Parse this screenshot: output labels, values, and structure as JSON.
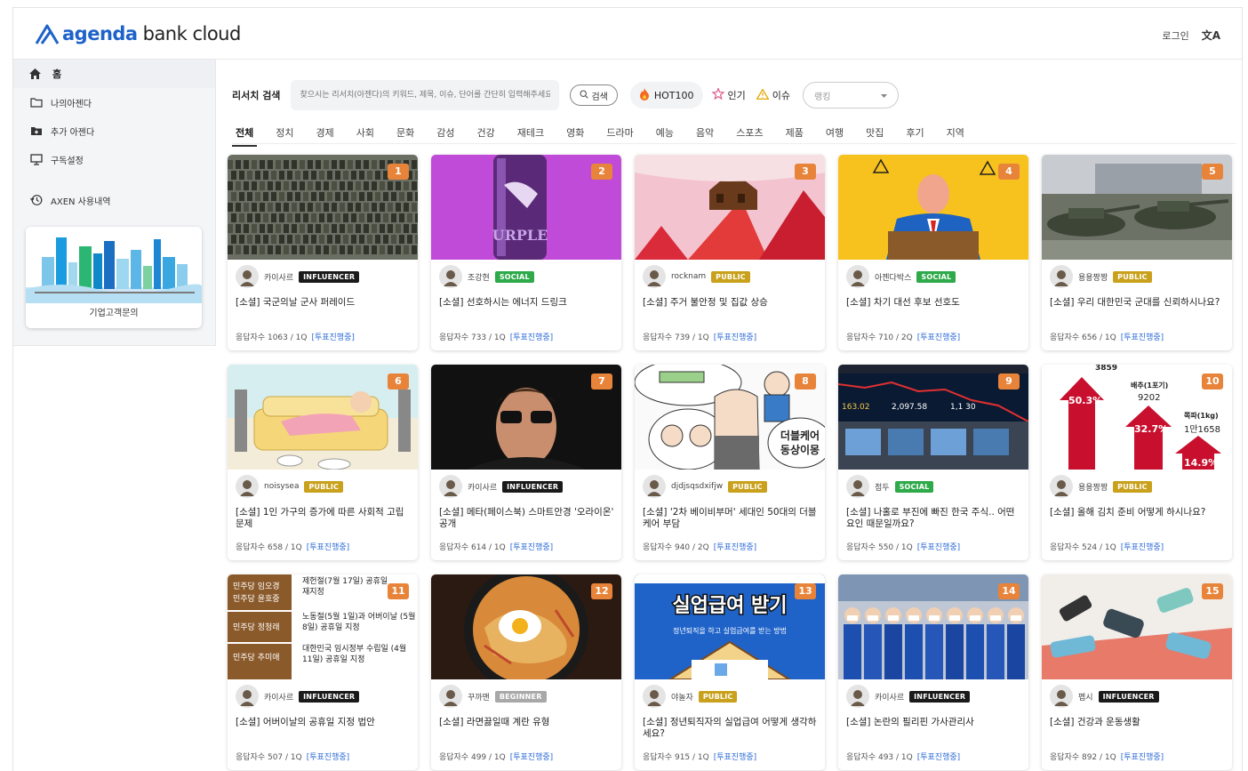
{
  "header": {
    "brand_a": "agenda",
    "brand_b": "bank cloud",
    "login": "로그인",
    "translate_icon": "translate-icon"
  },
  "sidebar": {
    "home": "홈",
    "items": [
      {
        "label": "나의아젠다",
        "icon": "folder-icon"
      },
      {
        "label": "추가 아젠다",
        "icon": "folder-plus-icon"
      },
      {
        "label": "구독설정",
        "icon": "monitor-icon"
      },
      {
        "label": "AXEN 사용내역",
        "icon": "history-icon"
      }
    ],
    "card_label": "기업고객문의"
  },
  "search": {
    "title": "리서치 검색",
    "placeholder": "찾으시는 리서치(아젠다)의 키워드, 제목, 이슈, 단어를 간단히 입력해주세요",
    "button": "검색",
    "hot": "HOT100",
    "popular": "인기",
    "issue": "이슈",
    "select_value": "랭킹"
  },
  "tabs": [
    "전체",
    "정치",
    "경제",
    "사회",
    "문화",
    "감성",
    "건강",
    "재테크",
    "영화",
    "드라마",
    "예능",
    "음악",
    "스포츠",
    "제품",
    "여행",
    "맛집",
    "후기",
    "지역"
  ],
  "badge_colors": {
    "INFLUENCER": "#1a1a1a",
    "SOCIAL": "#2eaa4a",
    "PUBLIC": "#c9a11c",
    "BEGINNER": "#a8a8a8"
  },
  "accent": "#e8843a",
  "cards": [
    {
      "rank": "1",
      "author": "카이사르",
      "badge": "INFLUENCER",
      "title": "[소셜] 국군의날 군사 퍼레이드",
      "stat": "응답자수 1063 / 1Q",
      "vote": "[투표진행중]"
    },
    {
      "rank": "2",
      "author": "조강현",
      "badge": "SOCIAL",
      "title": "[소셜] 선호하시는 에너지 드링크",
      "stat": "응답자수 733 / 1Q",
      "vote": "[투표진행중]"
    },
    {
      "rank": "3",
      "author": "rocknam",
      "badge": "PUBLIC",
      "title": "[소셜] 주거 불안정 및 집값 상승",
      "stat": "응답자수 739 / 1Q",
      "vote": "[투표진행중]"
    },
    {
      "rank": "4",
      "author": "아젠다박스",
      "badge": "SOCIAL",
      "title": "[소셜] 차기 대선 후보 선호도",
      "stat": "응답자수 710 / 2Q",
      "vote": "[투표진행중]"
    },
    {
      "rank": "5",
      "author": "용용짱짱",
      "badge": "PUBLIC",
      "title": "[소셜] 우리 대한민국 군대를 신뢰하시나요?",
      "stat": "응답자수 656 / 1Q",
      "vote": "[투표진행중]"
    },
    {
      "rank": "6",
      "author": "noisysea",
      "badge": "PUBLIC",
      "title": "[소셜] 1인 가구의 증가에 따른 사회적 고립 문제",
      "stat": "응답자수 658 / 1Q",
      "vote": "[투표진행중]"
    },
    {
      "rank": "7",
      "author": "카이사르",
      "badge": "INFLUENCER",
      "title": "[소셜] 메타(페이스북) 스마트안경 '오라이온' 공개",
      "stat": "응답자수 614 / 1Q",
      "vote": "[투표진행중]"
    },
    {
      "rank": "8",
      "author": "djdjsqsdxifjw",
      "badge": "PUBLIC",
      "title": "[소셜] '2차 베이비부머' 세대인 50대의 더블케어 부담",
      "stat": "응답자수 940 / 2Q",
      "vote": "[투표진행중]"
    },
    {
      "rank": "9",
      "author": "점두",
      "badge": "SOCIAL",
      "title": "[소셜] 나홀로 부진에 빠진 한국 주식.. 어떤 요인 때문일까요?",
      "stat": "응답자수 550 / 1Q",
      "vote": "[투표진행중]"
    },
    {
      "rank": "10",
      "author": "용용짱짱",
      "badge": "PUBLIC",
      "title": "[소셜] 올해 김치 준비 어떻게 하시나요?",
      "stat": "응답자수 524 / 1Q",
      "vote": "[투표진행중]"
    },
    {
      "rank": "11",
      "author": "카이사르",
      "badge": "INFLUENCER",
      "title": "[소셜] 어버이날의 공휴일 지정 법안",
      "stat": "응답자수 507 / 1Q",
      "vote": "[투표진행중]"
    },
    {
      "rank": "12",
      "author": "꾸까맨",
      "badge": "BEGINNER",
      "title": "[소셜] 라면끓일때 계란 유형",
      "stat": "응답자수 499 / 1Q",
      "vote": "[투표진행중]"
    },
    {
      "rank": "13",
      "author": "야놀자",
      "badge": "PUBLIC",
      "title": "[소셜] 정년퇴직자의 실업급여 어떻게 생각하세요?",
      "stat": "응답자수 915 / 1Q",
      "vote": "[투표진행중]"
    },
    {
      "rank": "14",
      "author": "카이사르",
      "badge": "INFLUENCER",
      "title": "[소셜] 논란의 필리핀 가사관리사",
      "stat": "응답자수 493 / 1Q",
      "vote": "[투표진행중]"
    },
    {
      "rank": "15",
      "author": "펩시",
      "badge": "INFLUENCER",
      "title": "[소셜] 건강과 운동생활",
      "stat": "응답자수 892 / 1Q",
      "vote": "[투표진행중]"
    }
  ],
  "thumb_text": {
    "t8": "더블케어\n동상이몽",
    "t10": [
      "3859",
      "배추(1포기)",
      "50.3%",
      "9202",
      "쪽파(1kg)",
      "32.7%",
      "1만1658",
      "14.9%"
    ],
    "t9": [
      "163.02",
      "2,097.58",
      "1,1 30"
    ],
    "t11": [
      "민주당 임오경",
      "민주당 윤호중",
      "제헌절(7월 17일) 공휴일 재지정",
      "민주당 정청래",
      "노동절(5월 1일)과 어버이날 (5월 8일) 공휴일 지정",
      "민주당 추미애",
      "대한민국 임시정부 수립일 (4월 11일) 공휴일 지정"
    ],
    "t13": [
      "실업급여 받기",
      "정년퇴직을 하고 실업급여를 받는 방법"
    ]
  }
}
